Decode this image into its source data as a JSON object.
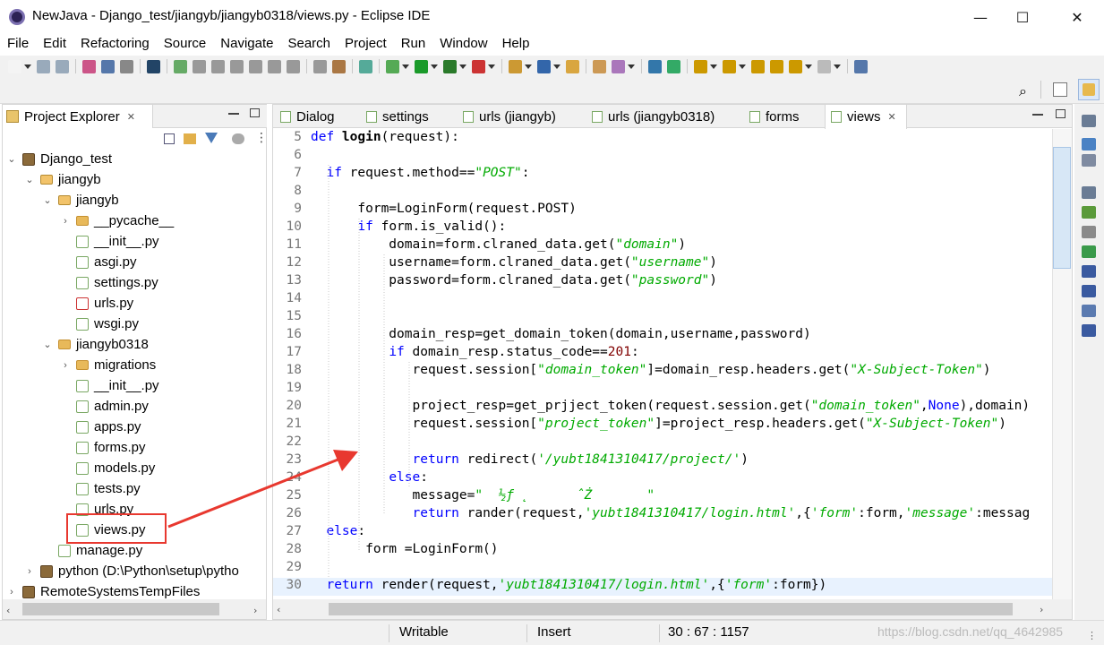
{
  "window": {
    "title": "NewJava - Django_test/jiangyb/jiangyb0318/views.py - Eclipse IDE",
    "minimize_glyph": "—",
    "maximize_glyph": "☐",
    "close_glyph": "✕"
  },
  "menu": [
    "File",
    "Edit",
    "Refactoring",
    "Source",
    "Navigate",
    "Search",
    "Project",
    "Run",
    "Window",
    "Help"
  ],
  "project_explorer": {
    "tab_label": "Project Explorer",
    "close_glyph": "✕",
    "tree": [
      {
        "label": "Django_test",
        "depth": 0,
        "twisty": "⌄",
        "icon": "project-icon"
      },
      {
        "label": "jiangyb",
        "depth": 1,
        "twisty": "⌄",
        "icon": "package-icon"
      },
      {
        "label": "jiangyb",
        "depth": 2,
        "twisty": "⌄",
        "icon": "package-icon"
      },
      {
        "label": "__pycache__",
        "depth": 3,
        "twisty": "›",
        "icon": "folder-icon"
      },
      {
        "label": "__init__.py",
        "depth": 3,
        "twisty": "",
        "icon": "python-file-icon"
      },
      {
        "label": "asgi.py",
        "depth": 3,
        "twisty": "",
        "icon": "python-file-icon"
      },
      {
        "label": "settings.py",
        "depth": 3,
        "twisty": "",
        "icon": "python-file-icon"
      },
      {
        "label": "urls.py",
        "depth": 3,
        "twisty": "",
        "icon": "python-file-error-icon"
      },
      {
        "label": "wsgi.py",
        "depth": 3,
        "twisty": "",
        "icon": "python-file-icon"
      },
      {
        "label": "jiangyb0318",
        "depth": 2,
        "twisty": "⌄",
        "icon": "folder-icon"
      },
      {
        "label": "migrations",
        "depth": 3,
        "twisty": "›",
        "icon": "folder-icon"
      },
      {
        "label": "__init__.py",
        "depth": 3,
        "twisty": "",
        "icon": "python-file-icon"
      },
      {
        "label": "admin.py",
        "depth": 3,
        "twisty": "",
        "icon": "python-file-icon"
      },
      {
        "label": "apps.py",
        "depth": 3,
        "twisty": "",
        "icon": "python-file-icon"
      },
      {
        "label": "forms.py",
        "depth": 3,
        "twisty": "",
        "icon": "python-file-icon"
      },
      {
        "label": "models.py",
        "depth": 3,
        "twisty": "",
        "icon": "python-file-icon"
      },
      {
        "label": "tests.py",
        "depth": 3,
        "twisty": "",
        "icon": "python-file-icon"
      },
      {
        "label": "urls.py",
        "depth": 3,
        "twisty": "",
        "icon": "python-file-icon"
      },
      {
        "label": "views.py",
        "depth": 3,
        "twisty": "",
        "icon": "python-file-icon",
        "selected": true
      },
      {
        "label": "manage.py",
        "depth": 2,
        "twisty": "",
        "icon": "python-file-icon"
      },
      {
        "label": "python  (D:\\Python\\setup\\pytho",
        "depth": 1,
        "twisty": "›",
        "icon": "interpreter-icon"
      },
      {
        "label": "RemoteSystemsTempFiles",
        "depth": 0,
        "twisty": "›",
        "icon": "project-icon"
      }
    ]
  },
  "editor": {
    "tabs": [
      {
        "label": "Dialog",
        "active": false
      },
      {
        "label": "settings",
        "active": false
      },
      {
        "label": "urls (jiangyb)",
        "active": false
      },
      {
        "label": "urls (jiangyb0318)",
        "active": false
      },
      {
        "label": "forms",
        "active": false
      },
      {
        "label": "views",
        "active": true,
        "close": "✕"
      }
    ],
    "lines": [
      {
        "n": "5",
        "segs": [
          [
            "kw",
            "def "
          ],
          [
            "fn",
            "login"
          ],
          [
            "",
            "(request):"
          ]
        ]
      },
      {
        "n": "6",
        "segs": []
      },
      {
        "n": "7",
        "segs": [
          [
            "",
            "  "
          ],
          [
            "kw",
            "if"
          ],
          [
            "",
            " request.method=="
          ],
          [
            "str",
            "\"POST\""
          ],
          [
            "",
            ":"
          ]
        ]
      },
      {
        "n": "8",
        "segs": []
      },
      {
        "n": "9",
        "segs": [
          [
            "",
            "      form=LoginForm(request.POST)"
          ]
        ]
      },
      {
        "n": "10",
        "segs": [
          [
            "",
            "      "
          ],
          [
            "kw",
            "if"
          ],
          [
            "",
            " form.is_valid():"
          ]
        ]
      },
      {
        "n": "11",
        "segs": [
          [
            "",
            "          domain=form.clraned_data.get("
          ],
          [
            "str",
            "\"domain\""
          ],
          [
            "",
            ")"
          ]
        ]
      },
      {
        "n": "12",
        "segs": [
          [
            "",
            "          username=form.clraned_data.get("
          ],
          [
            "str",
            "\"username\""
          ],
          [
            "",
            ")"
          ]
        ]
      },
      {
        "n": "13",
        "segs": [
          [
            "",
            "          password=form.clraned_data.get("
          ],
          [
            "str",
            "\"password\""
          ],
          [
            "",
            ")"
          ]
        ]
      },
      {
        "n": "14",
        "segs": []
      },
      {
        "n": "15",
        "segs": []
      },
      {
        "n": "16",
        "segs": [
          [
            "",
            "          domain_resp=get_domain_token(domain,username,password)"
          ]
        ]
      },
      {
        "n": "17",
        "segs": [
          [
            "",
            "          "
          ],
          [
            "kw",
            "if"
          ],
          [
            "",
            " domain_resp.status_code=="
          ],
          [
            "num",
            "201"
          ],
          [
            "",
            ":"
          ]
        ]
      },
      {
        "n": "18",
        "segs": [
          [
            "",
            "             request.session["
          ],
          [
            "str",
            "\"domain_token\""
          ],
          [
            "",
            "]=domain_resp.headers.get("
          ],
          [
            "str",
            "\"X-Subject-Token\""
          ],
          [
            "",
            ")"
          ]
        ]
      },
      {
        "n": "19",
        "segs": []
      },
      {
        "n": "20",
        "segs": [
          [
            "",
            "             project_resp=get_prjject_token(request.session.get("
          ],
          [
            "str",
            "\"domain_token\""
          ],
          [
            "",
            ","
          ],
          [
            "kw",
            "None"
          ],
          [
            "",
            "),domain)"
          ]
        ]
      },
      {
        "n": "21",
        "segs": [
          [
            "",
            "             request.session["
          ],
          [
            "str",
            "\"project_token\""
          ],
          [
            "",
            "]=project_resp.headers.get("
          ],
          [
            "str",
            "\"X-Subject-Token\""
          ],
          [
            "",
            ")"
          ]
        ]
      },
      {
        "n": "22",
        "segs": []
      },
      {
        "n": "23",
        "segs": [
          [
            "",
            "             "
          ],
          [
            "kw",
            "return"
          ],
          [
            "",
            " redirect("
          ],
          [
            "str",
            "'/yubt1841310417/project/'"
          ],
          [
            "",
            ")"
          ]
        ]
      },
      {
        "n": "24",
        "segs": [
          [
            "",
            "          "
          ],
          [
            "kw",
            "else"
          ],
          [
            "",
            ":"
          ]
        ]
      },
      {
        "n": "25",
        "segs": [
          [
            "",
            "             message="
          ],
          [
            "str",
            "\"  ½ƒ ˛      ˆŻ       \""
          ]
        ]
      },
      {
        "n": "26",
        "segs": [
          [
            "",
            "             "
          ],
          [
            "kw",
            "return"
          ],
          [
            "",
            " rander(request,"
          ],
          [
            "str",
            "'yubt1841310417/login.html'"
          ],
          [
            "",
            ",{"
          ],
          [
            "str",
            "'form'"
          ],
          [
            "",
            ":form,"
          ],
          [
            "str",
            "'message'"
          ],
          [
            "",
            ":messag"
          ]
        ]
      },
      {
        "n": "27",
        "segs": [
          [
            "kw",
            "  else"
          ],
          [
            "",
            ":"
          ]
        ]
      },
      {
        "n": "28",
        "segs": [
          [
            "",
            "       form =LoginForm()"
          ]
        ]
      },
      {
        "n": "29",
        "segs": []
      },
      {
        "n": "30",
        "segs": [
          [
            "",
            "  "
          ],
          [
            "kw",
            "return"
          ],
          [
            "",
            " render(request,"
          ],
          [
            "str",
            "'yubt1841310417/login.html'"
          ],
          [
            "",
            ",{"
          ],
          [
            "str",
            "'form'"
          ],
          [
            "",
            ":form})"
          ]
        ],
        "highlight": true
      }
    ]
  },
  "status": {
    "writable": "Writable",
    "insert": "Insert",
    "position": "30 : 67 : 1157",
    "watermark": "https://blog.csdn.net/qq_4642985"
  },
  "colors": {
    "keyword": "#0000ff",
    "string": "#00aa00",
    "number": "#800000",
    "annotation": "#e8382f"
  }
}
